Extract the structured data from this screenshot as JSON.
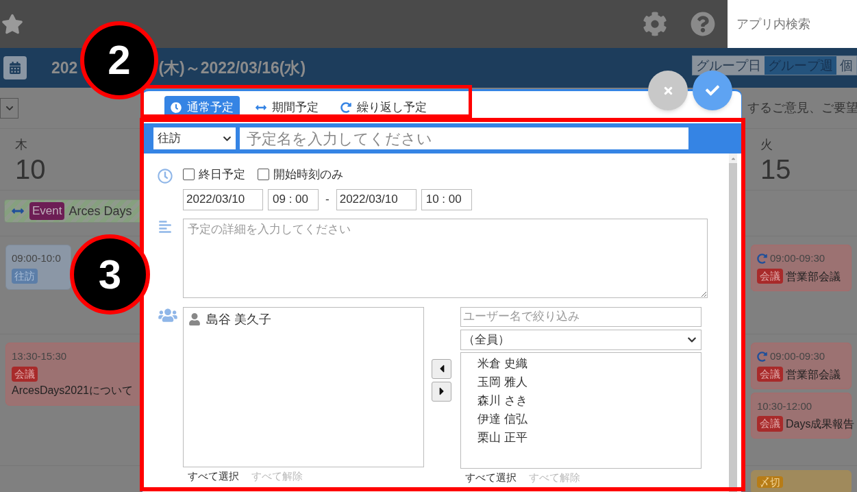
{
  "topbar": {
    "search": {
      "placeholder": "アプリ内検索"
    }
  },
  "header": {
    "date_start": "202",
    "date_rest": "(木)～2022/03/16(水)",
    "views": [
      {
        "label": "グループ日",
        "selected": false
      },
      {
        "label": "グループ週",
        "selected": true
      },
      {
        "label": "個",
        "selected": false
      }
    ]
  },
  "notice": "するご意見、ご要望",
  "days": [
    {
      "weekday": "木",
      "day": "10"
    },
    {
      "weekday": "火",
      "day": "15"
    }
  ],
  "banner": {
    "badge": "Event",
    "title": "Arces Days"
  },
  "rows": [
    {
      "left": [
        {
          "kind": "visit",
          "repeat": false,
          "time": "09:00-10:0",
          "tag": "往訪"
        }
      ],
      "right": [
        {
          "kind": "meeting",
          "repeat": true,
          "time": "09:00-09:30",
          "tag": "会議",
          "title": "営業部会議"
        }
      ]
    },
    {
      "left": [
        {
          "kind": "meeting",
          "repeat": false,
          "time": "13:30-15:30",
          "tag": "会議",
          "title": "ArcesDays2021について"
        }
      ],
      "right": [
        {
          "kind": "meeting",
          "repeat": true,
          "time": "09:00-09:30",
          "tag": "会議",
          "title": "営業部会議"
        },
        {
          "kind": "meeting",
          "repeat": false,
          "time": "10:30-12:00",
          "tag": "会議",
          "title": "Days成果報告"
        }
      ]
    },
    {
      "left": [],
      "right": [
        {
          "kind": "deadline",
          "tag": "〆切"
        }
      ]
    }
  ],
  "dialog": {
    "tabs": [
      {
        "kind": "single",
        "label": "通常予定",
        "selected": true
      },
      {
        "kind": "period",
        "label": "期間予定",
        "selected": false
      },
      {
        "kind": "repeat",
        "label": "繰り返し予定",
        "selected": false
      }
    ],
    "category": "往訪",
    "title": {
      "placeholder": "予定名を入力してください"
    },
    "options": [
      {
        "label": "終日予定",
        "checked": false
      },
      {
        "label": "開始時刻のみ",
        "checked": false
      }
    ],
    "start_date": "2022/03/10",
    "start_time": "09 : 00",
    "separator": "-",
    "end_date": "2022/03/10",
    "end_time": "10 : 00",
    "detail": {
      "placeholder": "予定の詳細を入力してください"
    },
    "participants": [
      "島谷 美久子"
    ],
    "filter": {
      "placeholder": "ユーザー名で絞り込み"
    },
    "group": "（全員）",
    "candidates": [
      "米倉 史織",
      "玉岡 雅人",
      "森川 さき",
      "伊達 信弘",
      "栗山 正平"
    ],
    "participant_links": [
      {
        "label": "すべて選択",
        "disabled": false
      },
      {
        "label": "すべて解除",
        "disabled": true
      }
    ],
    "candidate_links": [
      {
        "label": "すべて選択",
        "disabled": false
      },
      {
        "label": "すべて解除",
        "disabled": true
      }
    ]
  },
  "annotations": [
    {
      "label": "2"
    },
    {
      "label": "3"
    }
  ]
}
